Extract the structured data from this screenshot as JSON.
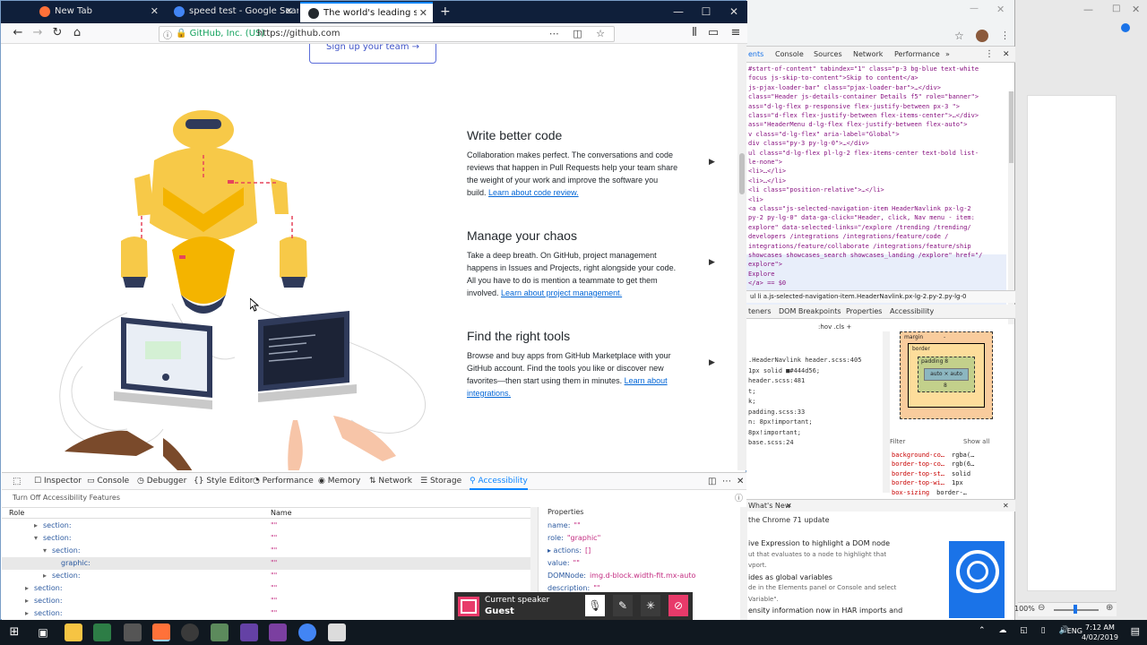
{
  "firefox": {
    "tabs": [
      {
        "title": "New Tab",
        "favicon_color": "#ff7139"
      },
      {
        "title": "speed test - Google Search",
        "favicon_color": "#4285f4"
      },
      {
        "title": "The world's leading software d",
        "favicon_color": "#24292e"
      }
    ],
    "new_tab_symbol": "+",
    "url_identity": "GitHub, Inc. (US)",
    "url": "https://github.com"
  },
  "page": {
    "signup_label": "Sign up your team →",
    "features": [
      {
        "title": "Write better code",
        "body": "Collaboration makes perfect. The conversations and code reviews that happen in Pull Requests help your team share the weight of your work and improve the software you build.",
        "link": "Learn about code review."
      },
      {
        "title": "Manage your chaos",
        "body": "Take a deep breath. On GitHub, project management happens in Issues and Projects, right alongside your code. All you have to do is mention a teammate to get them involved.",
        "link": "Learn about project management."
      },
      {
        "title": "Find the right tools",
        "body": "Browse and buy apps from GitHub Marketplace with your GitHub account. Find the tools you like or discover new favorites—then start using them in minutes.",
        "link": "Learn about integrations."
      }
    ]
  },
  "ff_devtools": {
    "tabs": [
      "Inspector",
      "Console",
      "Debugger",
      "Style Editor",
      "Performance",
      "Memory",
      "Network",
      "Storage",
      "Accessibility"
    ],
    "active_tab": "Accessibility",
    "toggle_label": "Turn Off Accessibility Features",
    "col_role": "Role",
    "col_name": "Name",
    "rows": [
      {
        "role": "section:",
        "name": "\"\"",
        "indent": 1,
        "twisty": "▸"
      },
      {
        "role": "section:",
        "name": "\"\"",
        "indent": 1,
        "twisty": "▾"
      },
      {
        "role": "section:",
        "name": "\"\"",
        "indent": 2,
        "twisty": "▾"
      },
      {
        "role": "graphic:",
        "name": "\"\"",
        "indent": 3,
        "twisty": "",
        "selected": true
      },
      {
        "role": "section:",
        "name": "\"\"",
        "indent": 2,
        "twisty": "▸"
      },
      {
        "role": "section:",
        "name": "\"\"",
        "indent": 0,
        "twisty": "▸"
      },
      {
        "role": "section:",
        "name": "\"\"",
        "indent": 0,
        "twisty": "▸"
      },
      {
        "role": "section:",
        "name": "\"\"",
        "indent": 0,
        "twisty": "▸"
      }
    ],
    "properties_title": "Properties",
    "properties": [
      {
        "key": "name:",
        "val": "\"\""
      },
      {
        "key": "role:",
        "val": "\"graphic\""
      },
      {
        "key": "▸ actions:",
        "val": "[]"
      },
      {
        "key": "value:",
        "val": "\"\""
      },
      {
        "key": "DOMNode:",
        "val": "img.d-block.width-fit.mx-auto"
      },
      {
        "key": "description:",
        "val": "\"\""
      }
    ]
  },
  "chrome_devtools": {
    "tabs": [
      "ents",
      "Console",
      "Sources",
      "Network",
      "Performance",
      "»"
    ],
    "code_lines": [
      "#start-of-content\" tabindex=\"1\" class=\"p-3 bg-blue text-white",
      "focus js-skip-to-content\">Skip to content</a>",
      "js-pjax-loader-bar\" class=\"pjax-loader-bar\">…</div>",
      "class=\"Header js-details-container Details f5\" role=\"banner\">",
      "ass=\"d-lg-flex p-responsive flex-justify-between px-3 \">",
      "class=\"d-flex flex-justify-between flex-items-center\">…</div>",
      "ass=\"HeaderMenu d-lg-flex flex-justify-between flex-auto\">",
      "v class=\"d-lg-flex\" aria-label=\"Global\">",
      "div class=\"py-3 py-lg-0\">…</div>",
      "ul class=\"d-lg-flex pl-lg-2 flex-items-center text-bold list-",
      "le-none\">",
      "<li>…</li>",
      "<li>…</li>",
      "<li class=\"position-relative\">…</li>",
      "<li>",
      "  <a class=\"js-selected-navigation-item HeaderNavlink px-lg-2",
      "  py-2 py-lg-0\" data-ga-click=\"Header, click, Nav menu - item:",
      "  explore\" data-selected-links=\"/explore /trending /trending/",
      "  developers /integrations /integrations/feature/code /",
      "  integrations/feature/collaborate /integrations/feature/ship",
      "  showcases showcases_search showcases_landing /explore\" href=\"/",
      "  explore\">",
      "              Explore",
      "  </a> == $0"
    ],
    "breadcrumb": "ul  li  a.js-selected-navigation-item.HeaderNavlink.px-lg-2.py-2.py-lg-0",
    "lower_tabs": [
      "teners",
      "DOM Breakpoints",
      "Properties",
      "Accessibility"
    ],
    "hov_cls": ":hov .cls  +",
    "styles": [
      ".HeaderNavlink   header.scss:405",
      "1px solid ■#444d56;",
      "header.scss:481",
      "t;",
      "k;",
      "padding.scss:33",
      "n: 8px!important;",
      "8px!important;",
      "base.scss:24"
    ],
    "box_labels": {
      "margin": "margin",
      "border": "border",
      "padding": "padding 8",
      "content": "auto × auto",
      "dash": "-",
      "p8": "8"
    },
    "filter_label": "Filter",
    "show_all": "Show all",
    "computed": [
      {
        "k": "background-co…",
        "v": "rgba(…"
      },
      {
        "k": "border-top-co…",
        "v": "rgb(6…"
      },
      {
        "k": "border-top-st…",
        "v": "solid"
      },
      {
        "k": "border-top-wi…",
        "v": "1px"
      },
      {
        "k": "box-sizing",
        "v": "border-…"
      }
    ],
    "whats_new_tab": "What's New",
    "whats_new_title": "the Chrome 71 update",
    "whats_new_items": [
      "ive Expression to highlight a DOM node",
      "ut that evaluates to a node to highlight that",
      "vport.",
      "ides as global variables",
      "de in the Elements panel or Console and select",
      "Variable\".",
      "ensity information now in HAR imports and"
    ]
  },
  "speaker": {
    "label": "Current speaker",
    "name": "Guest"
  },
  "taskbar": {
    "lang": "ENG",
    "time": "7:12 AM",
    "date": "4/02/2019",
    "zoom": "100%"
  }
}
